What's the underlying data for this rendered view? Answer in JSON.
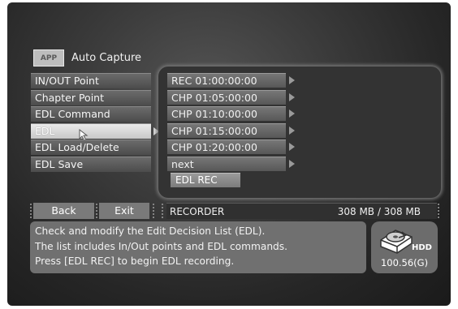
{
  "header": {
    "app_tag": "APP",
    "title": "Auto Capture"
  },
  "menu": {
    "items": [
      {
        "label": "IN/OUT Point"
      },
      {
        "label": "Chapter Point"
      },
      {
        "label": "EDL Command"
      },
      {
        "label": "EDL",
        "selected": true
      },
      {
        "label": "EDL Load/Delete"
      },
      {
        "label": "EDL Save"
      }
    ]
  },
  "edl": {
    "rows": [
      "REC 01:00:00:00",
      "CHP 01:05:00:00",
      "CHP 01:10:00:00",
      "CHP 01:15:00:00",
      "CHP 01:20:00:00",
      "next"
    ],
    "rec_button": "EDL REC"
  },
  "footer": {
    "back_label": "Back",
    "exit_label": "Exit",
    "status_label": "RECORDER",
    "status_size": "308 MB /  308 MB"
  },
  "info": {
    "line1": "Check and modify the Edit Decision List (EDL).",
    "line2": "The list includes In/Out points and EDL commands.",
    "line3": "Press [EDL REC] to begin EDL recording."
  },
  "hdd": {
    "label": "HDD",
    "capacity": "100.56(G)",
    "icon": "hdd-icon"
  },
  "colors": {
    "background": "#262626",
    "selected_item": "#d8d8d8",
    "button": "#7a7a7a"
  }
}
